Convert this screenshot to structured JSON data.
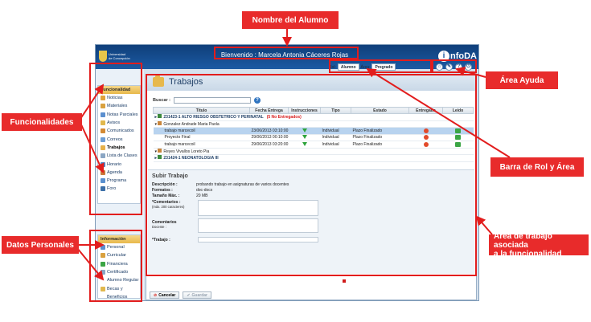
{
  "annotations": {
    "student_name": "Nombre del Alumno",
    "features": "Funcionalidades",
    "help_area": "Área Ayuda",
    "role_area_bar": "Barra de Rol y Área",
    "personal_data": "Datos Personales",
    "work_area_line1": "Área de trabajo asociada",
    "work_area_line2": "a la funcionalidad"
  },
  "header": {
    "uni_line1": "Universidad",
    "uni_line2": "de Concepción",
    "welcome": "Bienvenido : Marcela Antonia Cáceres Rojas",
    "brand": "nfoDA",
    "brand_letter": "i",
    "role_label": "Rol:",
    "role_value": "Alumno",
    "area_label": "Área:",
    "area_value": "Pregrado"
  },
  "sidebar": {
    "functionality_title": "Funcionalidad",
    "functionality_items": [
      {
        "label": "Noticias",
        "color": "#e0a23a"
      },
      {
        "label": "Materiales",
        "color": "#d9a13f"
      },
      {
        "label": "Notas Parciales",
        "color": "#5b8fcf"
      },
      {
        "label": "Avisos",
        "color": "#e1b84d"
      },
      {
        "label": "Comunicados",
        "color": "#d38a34"
      },
      {
        "label": "Correos",
        "color": "#6c9ed6"
      },
      {
        "label": "Trabajos",
        "color": "#e6b14a"
      },
      {
        "label": "Lista de Clases",
        "color": "#8aa6c4"
      },
      {
        "label": "Horario",
        "color": "#4e86c6"
      },
      {
        "label": "Agenda",
        "color": "#c97a3a"
      },
      {
        "label": "Programa",
        "color": "#5a90cf"
      },
      {
        "label": "Foro",
        "color": "#3c6fa8"
      }
    ],
    "info_title": "Información",
    "info_items": [
      {
        "label": "Personal",
        "color": "#5b8fcf"
      },
      {
        "label": "Curricular",
        "color": "#d9a13f"
      },
      {
        "label": "Financiera",
        "color": "#3ba545"
      },
      {
        "label": "Certificado",
        "color": "#8aa6c4"
      },
      {
        "label": "Alumno Regular",
        "color": ""
      },
      {
        "label": "Becas y",
        "color": "#e1b84d"
      },
      {
        "label": "Beneficios",
        "color": ""
      }
    ]
  },
  "main": {
    "title": "Trabajos",
    "search_label": "Buscar :",
    "search_value": "",
    "columns": [
      "Título",
      "Fecha Entrega",
      "Instrucciones",
      "Tipo",
      "Estado",
      "Entregado",
      "Leído"
    ],
    "rows": [
      {
        "kind": "group",
        "title": "231423-1 ALTO RIESGO OBSTETRICO Y PERINATAL",
        "extra": "(5 No Entregados)"
      },
      {
        "kind": "subgroup",
        "title": "Gonzalez Andrade Maria Paola"
      },
      {
        "kind": "item",
        "title": "trabajo marcecoil",
        "date": "23/06/2013 03:10:00",
        "type": "Individual",
        "state": "Plazo Finalizado",
        "selected": true
      },
      {
        "kind": "item",
        "title": "Proyecto Final",
        "date": "29/06/2013 00:10:00",
        "type": "Individual",
        "state": "Plazo Finalizado",
        "selected": false
      },
      {
        "kind": "item",
        "title": "trabajo marcecoil",
        "date": "29/06/2013 03:20:00",
        "type": "Individual",
        "state": "Plazo Finalizado",
        "selected": false
      },
      {
        "kind": "subgroup",
        "title": "Reyes Vivallos Loreto Pia"
      },
      {
        "kind": "group",
        "title": "231424-1 NEONATOLOGIA III",
        "extra": ""
      }
    ],
    "upload": {
      "title": "Subir Trabajo",
      "description_label": "Descripción :",
      "description_value": "probando trabajo en asignaturas de varios docentes",
      "formats_label": "Formatos :",
      "formats_value": "doc-docx",
      "maxsize_label": "Tamaño Máx. :",
      "maxsize_value": "20 MB",
      "comments_label": "*Comentarios :",
      "comments_hint": "(máx. 200 caracteres)",
      "teacher_comments_label": "Comentarios",
      "teacher_comments_label2": "Docente :",
      "file_label": "*Trabajo :"
    },
    "cancel_label": "Cancelar",
    "save_label": "Guardar"
  },
  "colors": {
    "annotation_red": "#e82b2b",
    "header_blue": "#1c5aa3"
  }
}
